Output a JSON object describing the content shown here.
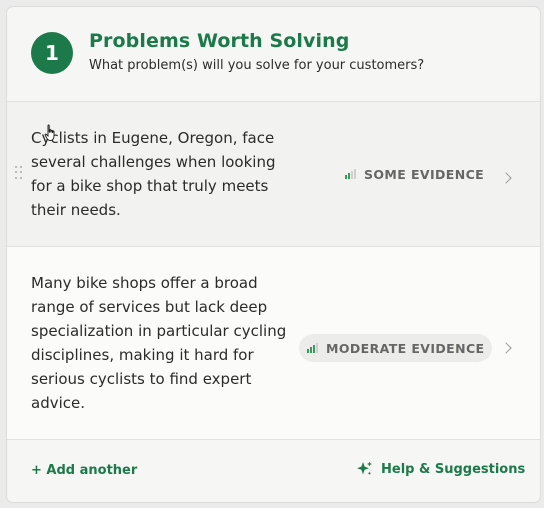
{
  "header": {
    "step_number": "1",
    "title": "Problems Worth Solving",
    "subtitle": "What problem(s) will you solve for your customers?"
  },
  "problems": [
    {
      "text": "Cyclists in Eugene, Oregon, face several challenges when looking for a bike shop that truly meets their needs.",
      "evidence_label": "SOME EVIDENCE",
      "evidence_level": 2,
      "evidence_max": 4
    },
    {
      "text": "Many bike shops offer a broad range of services but lack deep specialization in particular cycling disciplines, making it hard for serious cyclists to find expert advice.",
      "evidence_label": "MODERATE EVIDENCE",
      "evidence_level": 3,
      "evidence_max": 4
    }
  ],
  "footer": {
    "add_label": "+ Add another",
    "help_label": "Help & Suggestions"
  },
  "colors": {
    "accent": "#1c7a4a",
    "evidence_bar": "#3a9a5c"
  },
  "icons": [
    "drag-handle-icon",
    "signal-bars-icon",
    "chevron-right-icon",
    "sparkle-icon",
    "hand-cursor-icon"
  ]
}
